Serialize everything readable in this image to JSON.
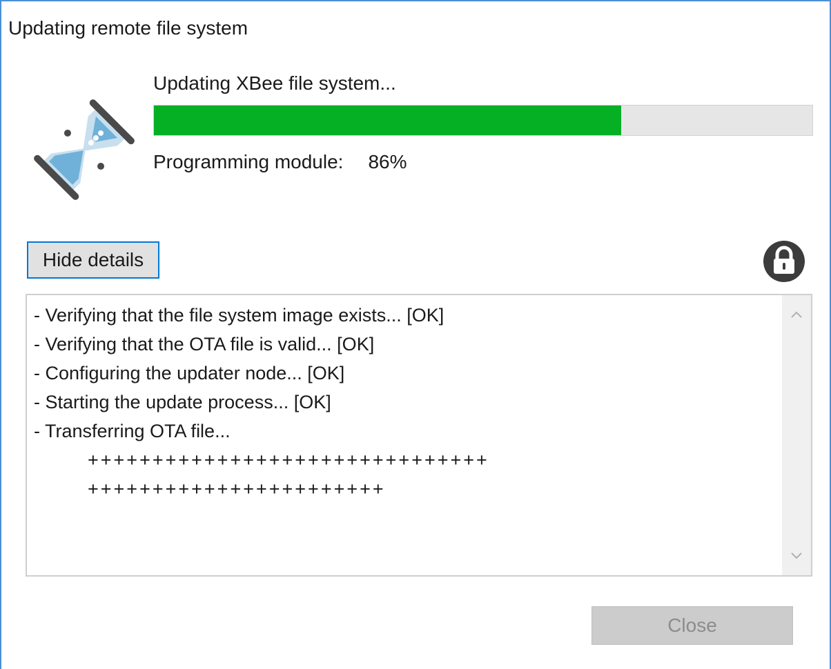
{
  "dialog": {
    "title": "Updating remote file system"
  },
  "status": {
    "heading": "Updating XBee file system...",
    "progress_label": "Programming module:",
    "progress_value": "86%",
    "progress_fraction": 0.71,
    "icon": "hourglass-icon"
  },
  "details": {
    "toggle_label": "Hide details",
    "lock_icon": "lock-icon",
    "log": [
      "- Verifying that the file system image exists... [OK]",
      "- Verifying that the OTA file is valid... [OK]",
      "- Configuring the updater node... [OK]",
      "- Starting the update process... [OK]",
      "- Transferring OTA file...",
      "+++++++++++++++++++++++++++++++",
      "+++++++++++++++++++++++"
    ]
  },
  "footer": {
    "close_label": "Close",
    "close_enabled": false
  },
  "colors": {
    "window_border": "#4a90d9",
    "progress_fill": "#06b025",
    "progress_track": "#e6e6e6",
    "focus_border": "#0078d7"
  }
}
